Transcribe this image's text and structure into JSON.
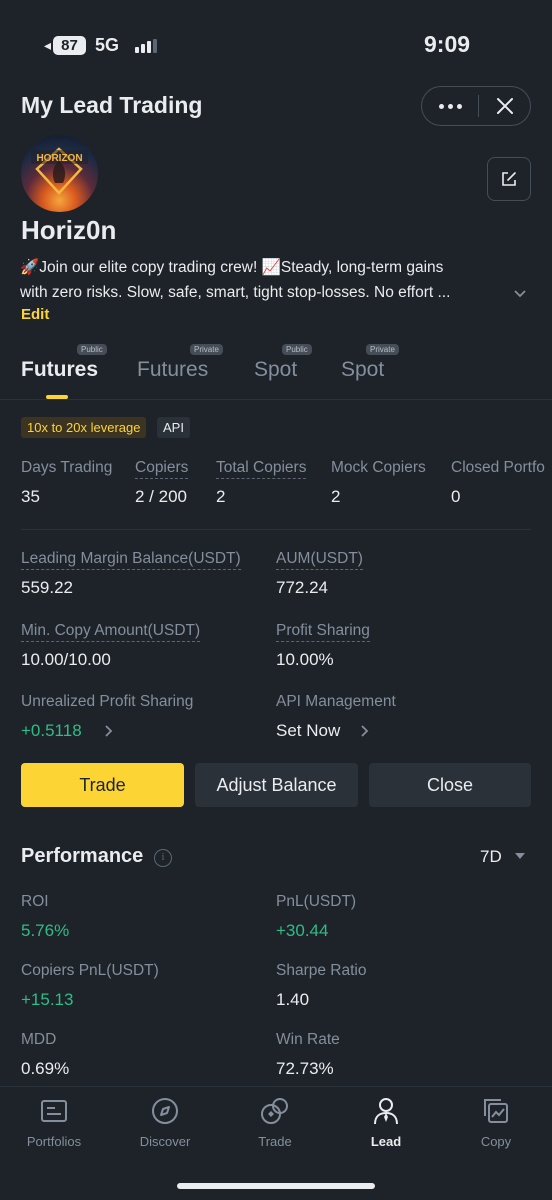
{
  "status_bar": {
    "battery": "87",
    "network": "5G",
    "time": "9:09"
  },
  "header": {
    "title": "My Lead Trading"
  },
  "profile": {
    "avatar_text": "HORIZON",
    "nickname": "Horiz0n",
    "bio_line1": "🚀Join our elite copy trading crew! 📈Steady, long-term gains",
    "bio_line2": "with zero risks. Slow, safe, smart, tight stop-losses. No effort ...",
    "edit_label": "Edit"
  },
  "tabs": [
    {
      "label": "Futures",
      "badge": "Public",
      "active": true
    },
    {
      "label": "Futures",
      "badge": "Private",
      "active": false
    },
    {
      "label": "Spot",
      "badge": "Public",
      "active": false
    },
    {
      "label": "Spot",
      "badge": "Private",
      "active": false
    }
  ],
  "tags": {
    "leverage": "10x to 20x leverage",
    "api": "API"
  },
  "stats": [
    {
      "label": "Days Trading",
      "value": "35"
    },
    {
      "label": "Copiers",
      "value": "2 / 200"
    },
    {
      "label": "Total Copiers",
      "value": "2"
    },
    {
      "label": "Mock Copiers",
      "value": "2"
    },
    {
      "label": "Closed Portfo",
      "value": "0"
    }
  ],
  "details": {
    "leading_margin_label": "Leading Margin Balance(USDT)",
    "leading_margin_value": "559.22",
    "aum_label": "AUM(USDT)",
    "aum_value": "772.24",
    "min_copy_label": "Min. Copy Amount(USDT)",
    "min_copy_value": "10.00/10.00",
    "profit_sharing_label": "Profit Sharing",
    "profit_sharing_value": "10.00%",
    "unrealized_label": "Unrealized Profit Sharing",
    "unrealized_value": "+0.5118",
    "api_mgmt_label": "API Management",
    "api_mgmt_value": "Set Now"
  },
  "actions": {
    "trade": "Trade",
    "adjust": "Adjust Balance",
    "close": "Close"
  },
  "performance": {
    "title": "Performance",
    "info_glyph": "i",
    "period": "7D",
    "roi_label": "ROI",
    "roi_value": "5.76%",
    "pnl_label": "PnL(USDT)",
    "pnl_value": "+30.44",
    "copiers_pnl_label": "Copiers PnL(USDT)",
    "copiers_pnl_value": "+15.13",
    "sharpe_label": "Sharpe Ratio",
    "sharpe_value": "1.40",
    "mdd_label": "MDD",
    "mdd_value": "0.69%",
    "win_rate_label": "Win Rate",
    "win_rate_value": "72.73%"
  },
  "bottom_nav": [
    {
      "label": "Portfolios",
      "icon": "portfolio-icon",
      "active": false
    },
    {
      "label": "Discover",
      "icon": "compass-icon",
      "active": false
    },
    {
      "label": "Trade",
      "icon": "trade-icon",
      "active": false
    },
    {
      "label": "Lead",
      "icon": "person-icon",
      "active": true
    },
    {
      "label": "Copy",
      "icon": "copy-icon",
      "active": false
    }
  ],
  "colors": {
    "background": "#1e2329",
    "accent": "#fcd535",
    "positive": "#2ebd85",
    "muted": "#848e9c"
  }
}
